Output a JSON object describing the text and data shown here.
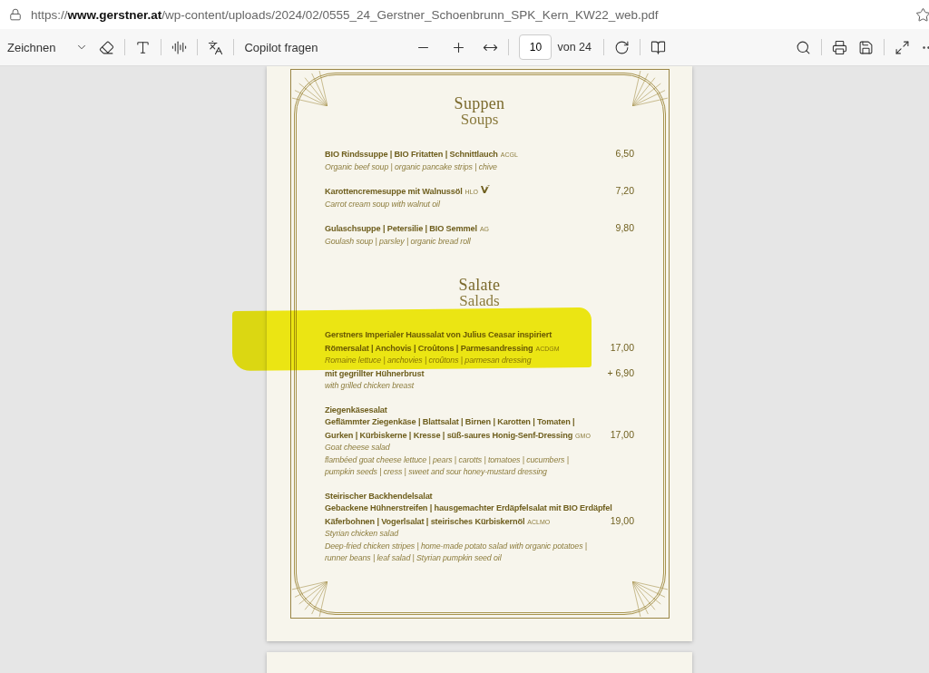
{
  "address_bar": {
    "url": "https://**www.gerstner.at**/wp-content/uploads/2024/02/0555_24_Gerstner_Schoenbrunn_SPK_Kern_KW22_web.pdf"
  },
  "toolbar": {
    "draw_label": "Zeichnen",
    "copilot_label": "Copilot fragen",
    "page_number": "10",
    "page_total": "von 24"
  },
  "page": {
    "sections": [
      {
        "title": "Suppen",
        "subtitle": "Soups",
        "items": [
          {
            "highlighted": false,
            "rows": [
              {
                "kind": "dish",
                "text": "BIO Rindssuppe | BIO Fritatten | Schnittlauch",
                "allergens": "ACGL",
                "price": "6,50"
              },
              {
                "kind": "translation",
                "text": "Organic beef soup | organic pancake strips | chive"
              }
            ]
          },
          {
            "highlighted": false,
            "rows": [
              {
                "kind": "dish",
                "text": "Karottencremesuppe mit Walnussöl",
                "allergens": "HLO",
                "vegan": true,
                "price": "7,20"
              },
              {
                "kind": "translation",
                "text": "Carrot cream soup with walnut oil"
              }
            ]
          },
          {
            "highlighted": false,
            "rows": [
              {
                "kind": "dish",
                "text": "Gulaschsuppe | Petersilie | BIO Semmel",
                "allergens": "AG",
                "price": "9,80"
              },
              {
                "kind": "translation",
                "text": "Goulash soup | parsley | organic bread roll"
              }
            ]
          }
        ]
      },
      {
        "title": "Salate",
        "subtitle": "Salads",
        "items": [
          {
            "highlighted": true,
            "rows": [
              {
                "kind": "title",
                "text": "Gerstners Imperialer Haussalat von Julius Ceasar inspiriert"
              },
              {
                "kind": "dish",
                "text": "Römersalat | Anchovis | Croûtons | Parmesandressing",
                "allergens": "ACDGM",
                "price": "17,00"
              },
              {
                "kind": "translation",
                "text": "Romaine lettuce | anchovies | croûtons | parmesan dressing"
              },
              {
                "kind": "dish",
                "text": "mit gegrillter Hühnerbrust",
                "price": "+ 6,90"
              },
              {
                "kind": "translation",
                "text": "with grilled chicken breast"
              }
            ]
          },
          {
            "highlighted": false,
            "rows": [
              {
                "kind": "title",
                "text": "Ziegenkäsesalat"
              },
              {
                "kind": "dish",
                "text": "Geflämmter Ziegenkäse | Blattsalat | Birnen | Karotten | Tomaten |"
              },
              {
                "kind": "dish",
                "text": "Gurken | Kürbiskerne | Kresse | süß-saures Honig-Senf-Dressing",
                "allergens": "GMO",
                "price": "17,00"
              },
              {
                "kind": "translation",
                "text": "Goat cheese salad"
              },
              {
                "kind": "translation",
                "text": "flambéed goat cheese lettuce | pears | carotts | tomatoes | cucumbers |"
              },
              {
                "kind": "translation",
                "text": "pumpkin seeds | cress | sweet and sour honey-mustard dressing"
              }
            ]
          },
          {
            "highlighted": false,
            "rows": [
              {
                "kind": "title",
                "text": "Steirischer Backhendelsalat"
              },
              {
                "kind": "dish",
                "text": "Gebackene Hühnerstreifen | hausgemachter Erdäpfelsalat mit BIO Erdäpfel"
              },
              {
                "kind": "dish",
                "text": "Käferbohnen |  Vogerlsalat | steirisches Kürbiskernöl",
                "allergens": "ACLMO",
                "price": "19,00"
              },
              {
                "kind": "translation",
                "text": "Styrian chicken salad"
              },
              {
                "kind": "translation",
                "text": "Deep-fried chicken stripes | home-made potato salad with organic potatoes |"
              },
              {
                "kind": "translation",
                "text": "runner beans | leaf salad | Styrian pumpkin seed oil"
              }
            ]
          }
        ]
      }
    ]
  }
}
